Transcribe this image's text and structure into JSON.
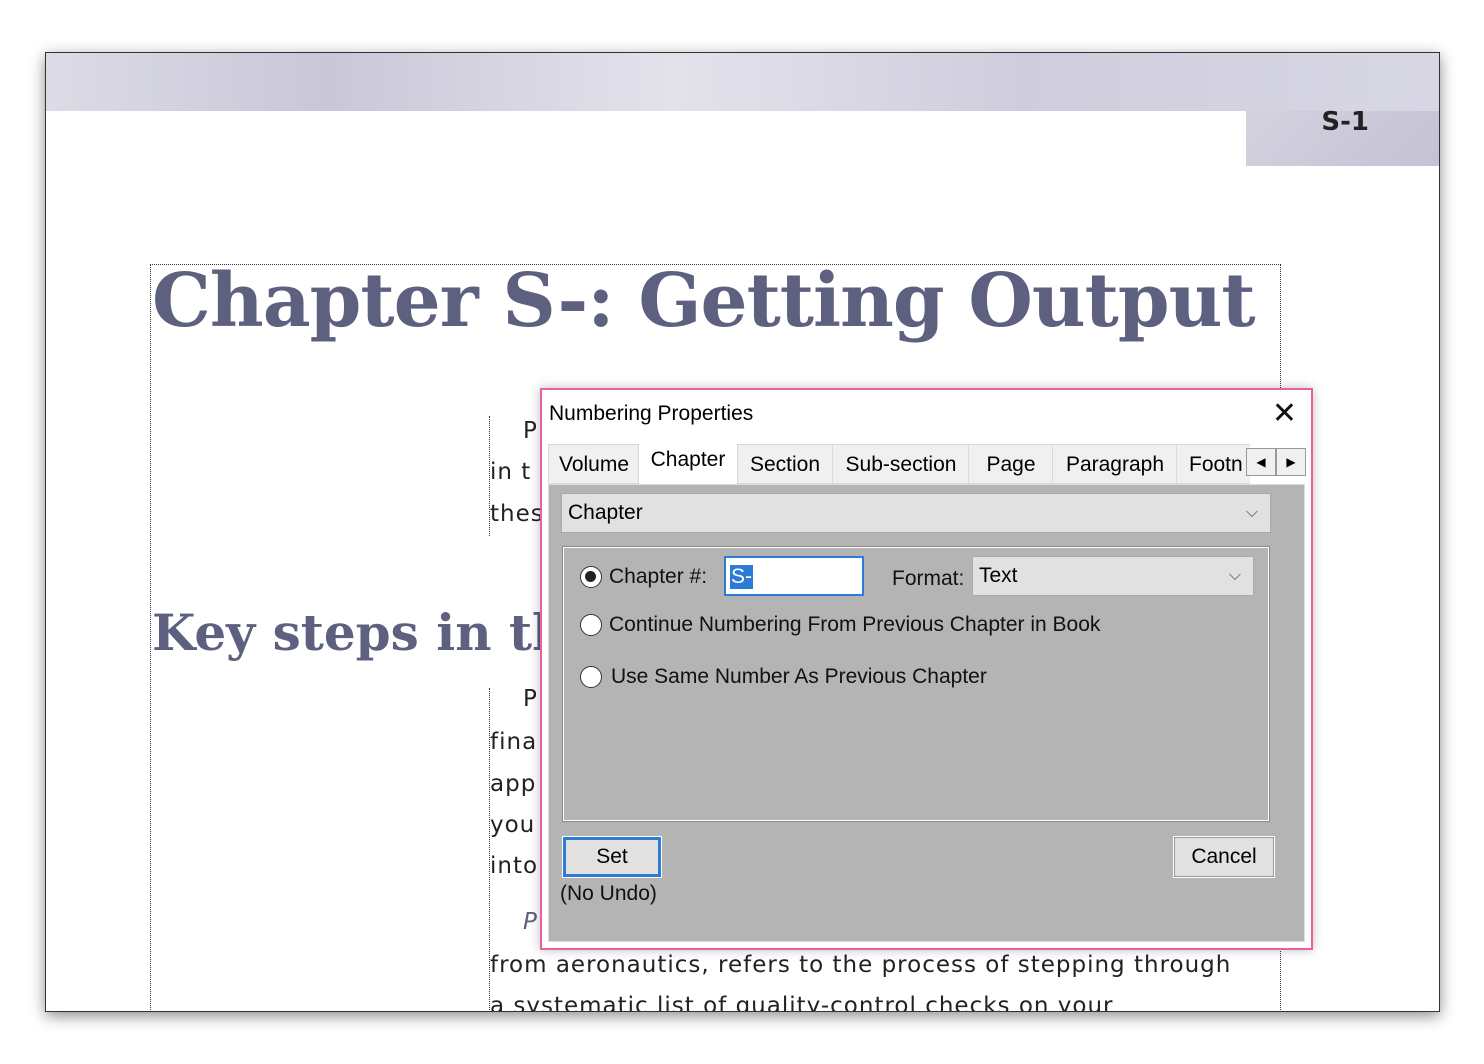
{
  "page": {
    "folio": "S-1",
    "chapter_heading": "Chapter S-: Getting Output",
    "section_heading": "Key steps in the",
    "body_fragments": [
      "P",
      "in t",
      "thes",
      "P",
      "fina",
      "app",
      "you",
      "into",
      "P"
    ],
    "body_line_1": "from aeronautics, refers to the process of stepping through",
    "body_line_2": "a systematic list of quality-control checks on your"
  },
  "dialog": {
    "title": "Numbering Properties",
    "tabs": [
      "Volume",
      "Chapter",
      "Section",
      "Sub-section",
      "Page",
      "Paragraph",
      "Footn"
    ],
    "active_tab": "Chapter",
    "scope_select": "Chapter",
    "options": {
      "chapter_num_label": "Chapter #:",
      "chapter_num_value": "S-",
      "format_label": "Format:",
      "format_value": "Text",
      "continue_label": "Continue Numbering From Previous Chapter in Book",
      "same_label": "Use Same Number As Previous Chapter",
      "selected": "Chapter #:"
    },
    "set_label": "Set",
    "no_undo": "(No Undo)",
    "cancel_label": "Cancel",
    "accent": "#e8609f"
  }
}
